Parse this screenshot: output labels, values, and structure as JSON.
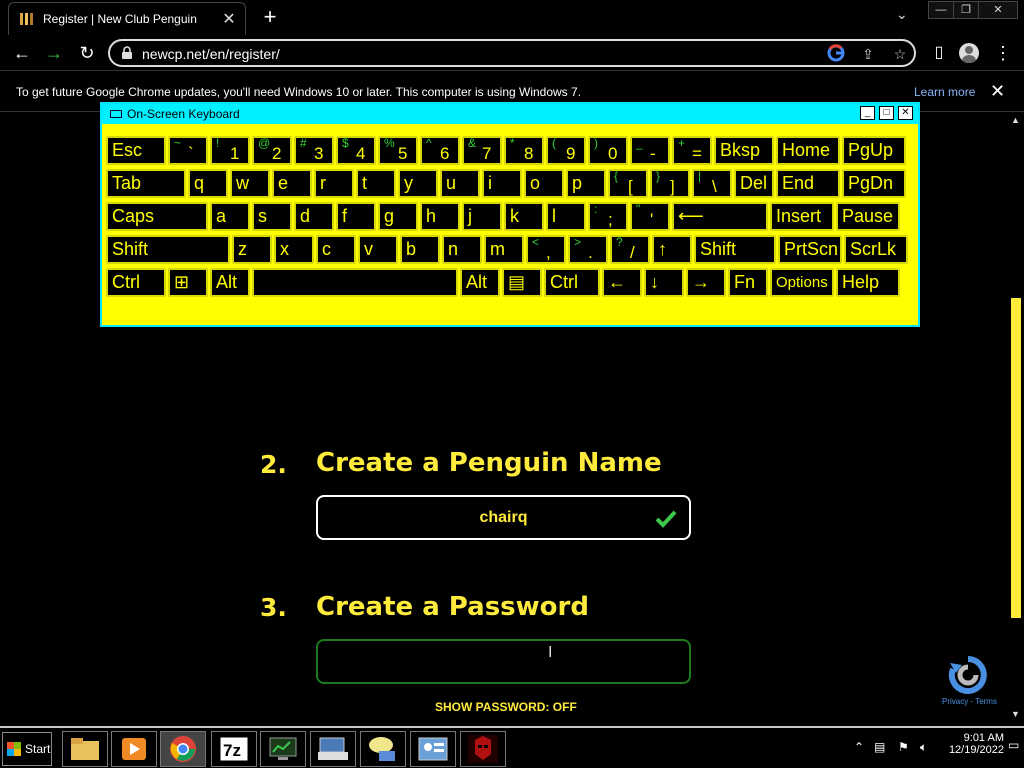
{
  "browser": {
    "tab_title": "Register | New Club Penguin",
    "tab_close": "✕",
    "new_tab": "+",
    "url": "newcp.net/en/register/"
  },
  "infobar": {
    "message": "To get future Google Chrome updates, you'll need Windows 10 or later. This computer is using Windows 7.",
    "link": "Learn more"
  },
  "page": {
    "step2_num": "2.",
    "step2_title": "Create a Penguin Name",
    "penguin_name_value": "chairq",
    "step3_num": "3.",
    "step3_title": "Create a Password",
    "password_value": "",
    "show_password": "SHOW PASSWORD: OFF",
    "recaptcha_links": "Privacy - Terms"
  },
  "osk": {
    "title": "On-Screen Keyboard",
    "rows": [
      [
        "Esc",
        "~ `",
        "! 1",
        "@ 2",
        "# 3",
        "$ 4",
        "% 5",
        "^ 6",
        "& 7",
        "* 8",
        "( 9",
        ") 0",
        "_ -",
        "+ =",
        "Bksp",
        "Home",
        "PgUp"
      ],
      [
        "Tab",
        "q",
        "w",
        "e",
        "r",
        "t",
        "y",
        "u",
        "i",
        "o",
        "p",
        "{ [",
        "} ]",
        "| \\",
        "Del",
        "End",
        "PgDn"
      ],
      [
        "Caps",
        "a",
        "s",
        "d",
        "f",
        "g",
        "h",
        "j",
        "k",
        "l",
        ": ;",
        "\" '",
        "⟵",
        "Insert",
        "Pause"
      ],
      [
        "Shift",
        "z",
        "x",
        "c",
        "v",
        "b",
        "n",
        "m",
        "< ,",
        "> .",
        "? /",
        "↑",
        "Shift",
        "PrtScn",
        "ScrLk"
      ],
      [
        "Ctrl",
        "⊞",
        "Alt",
        "",
        "Alt",
        "▤",
        "Ctrl",
        "←",
        "↓",
        "→",
        "Fn",
        "Options",
        "Help"
      ]
    ]
  },
  "taskbar": {
    "start_label": "Start",
    "time": "9:01 AM",
    "date": "12/19/2022"
  },
  "colors": {
    "accent": "#ffeb3b",
    "osk_bg": "#ffff00",
    "osk_title": "#00f0ff",
    "valid_green": "#3ec84b"
  }
}
